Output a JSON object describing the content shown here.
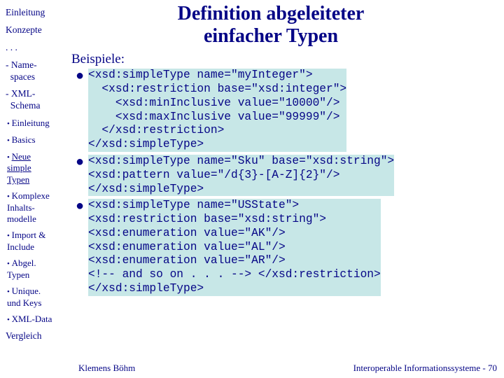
{
  "sidebar": {
    "items": [
      {
        "label": "Einleitung",
        "type": "top"
      },
      {
        "label": "Konzepte",
        "type": "top"
      },
      {
        "label": ". . .",
        "type": "top"
      },
      {
        "label": "- Name-\n  spaces",
        "type": "dash"
      },
      {
        "label": "- XML-\n  Schema",
        "type": "dash"
      },
      {
        "label": "Einleitung",
        "type": "dot"
      },
      {
        "label": "Basics",
        "type": "dot"
      },
      {
        "label": "Neue\nsimple\nTypen",
        "type": "dot",
        "active": true
      },
      {
        "label": "Komplexe\nInhalts-\nmodelle",
        "type": "dot"
      },
      {
        "label": "Import &\nInclude",
        "type": "dot"
      },
      {
        "label": "Abgel.\nTypen",
        "type": "dot"
      },
      {
        "label": "Unique.\nund Keys",
        "type": "dot"
      },
      {
        "label": "XML-Data",
        "type": "dot"
      },
      {
        "label": "Vergleich",
        "type": "top"
      }
    ]
  },
  "title_l1": "Definition abgeleiteter",
  "title_l2": "einfacher Typen",
  "subhead": "Beispiele:",
  "code1": "<xsd:simpleType name=\"myInteger\">\n  <xsd:restriction base=\"xsd:integer\">\n    <xsd:minInclusive value=\"10000\"/>\n    <xsd:maxInclusive value=\"99999\"/>\n  </xsd:restriction>\n</xsd:simpleType>",
  "code2": "<xsd:simpleType name=\"Sku\" base=\"xsd:string\">\n<xsd:pattern value=\"/d{3}-[A-Z]{2}\"/>\n</xsd:simpleType>",
  "code3": "<xsd:simpleType name=\"USState\">\n<xsd:restriction base=\"xsd:string\">\n<xsd:enumeration value=\"AK\"/>\n<xsd:enumeration value=\"AL\"/>\n<xsd:enumeration value=\"AR\"/>\n<!-- and so on . . . --> </xsd:restriction>\n</xsd:simpleType>",
  "footer_left": "Klemens Böhm",
  "footer_right": "Interoperable Informationssysteme - 70"
}
